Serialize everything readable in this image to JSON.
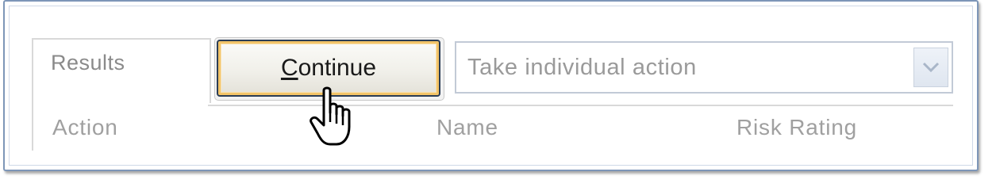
{
  "tab": {
    "label": "Results"
  },
  "continue_button": {
    "mnemonic": "C",
    "rest": "ontinue"
  },
  "action_select": {
    "selected": "Take individual action"
  },
  "columns": [
    "Action",
    "Name",
    "Risk Rating"
  ],
  "colors": {
    "frame_border": "#7d96b8",
    "button_focus": "#f3c468",
    "text_muted": "#a0a0a0"
  },
  "icons": {
    "dropdown": "chevron-down-icon",
    "cursor": "hand-pointer-icon"
  }
}
